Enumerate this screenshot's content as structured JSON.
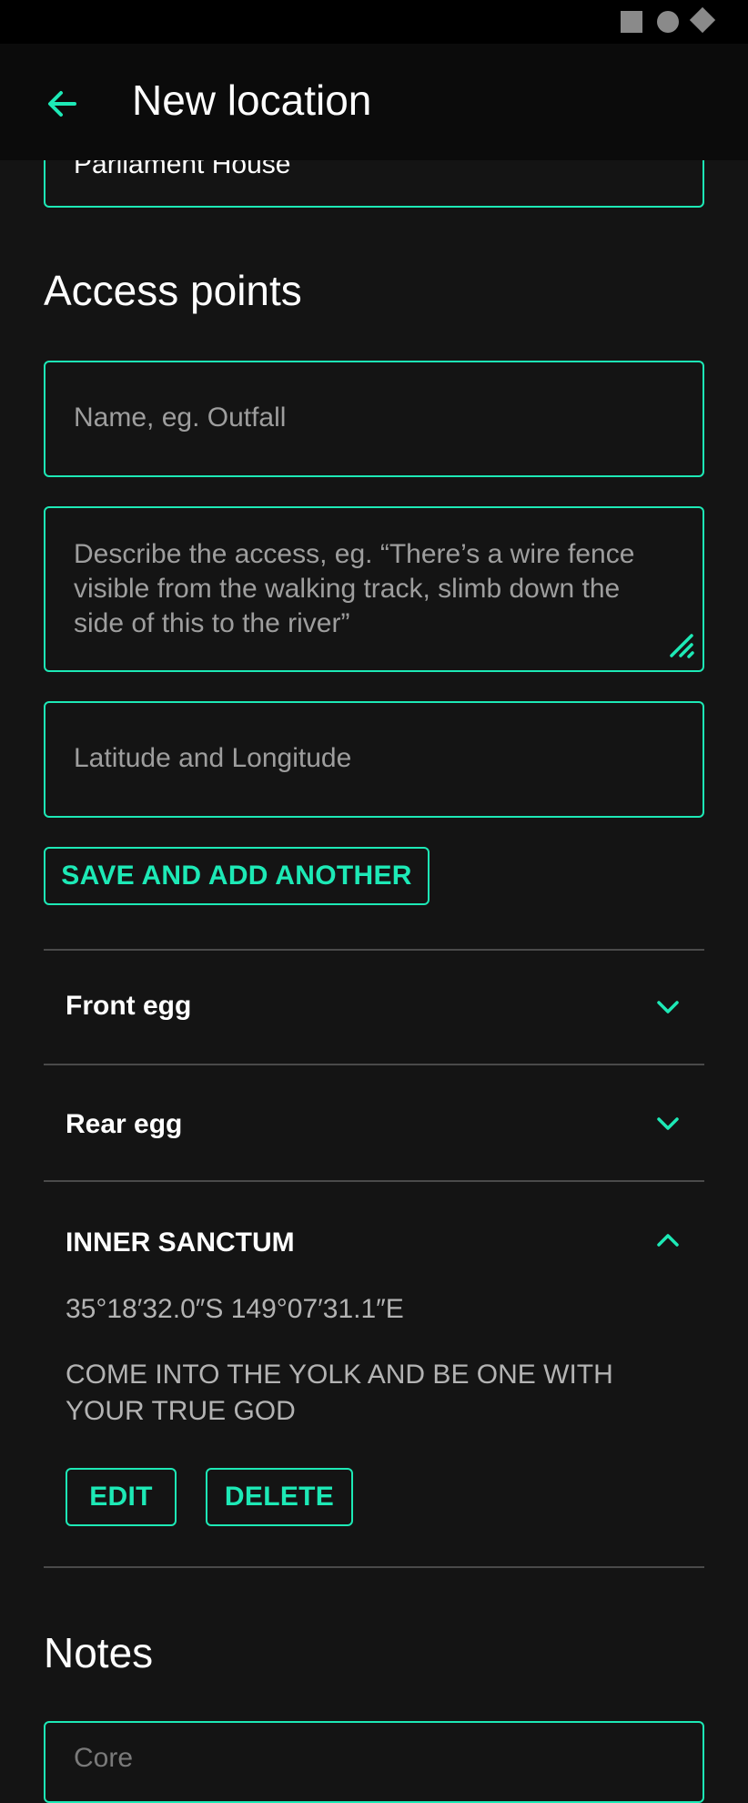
{
  "app": {
    "title": "New location"
  },
  "form": {
    "location_name_value": "Parliament House",
    "access_points_title": "Access points",
    "name_placeholder": "Name, eg. Outfall",
    "description_placeholder": "Describe the access, eg. “There’s a wire fence visible from the walking track, slimb down the side of this to the river”",
    "latlng_placeholder": "Latitude and Longitude",
    "save_add_another_label": "SAVE AND ADD ANOTHER"
  },
  "access_points": [
    {
      "name": "Front egg",
      "expanded": false
    },
    {
      "name": "Rear egg",
      "expanded": false
    },
    {
      "name": "INNER SANCTUM",
      "expanded": true,
      "coordinates": "35°18′32.0″S 149°07′31.1″E",
      "description": "COME INTO THE YOLK AND BE ONE WITH YOUR TRUE GOD",
      "edit_label": "EDIT",
      "delete_label": "DELETE"
    }
  ],
  "notes": {
    "title": "Notes",
    "placeholder": "Core"
  },
  "colors": {
    "accent": "#1de9b6",
    "background": "#141414",
    "appbar": "#0b0b0b"
  },
  "icons": {
    "back": "arrow-left-icon",
    "expand": "chevron-down-icon",
    "collapse": "chevron-up-icon",
    "resize": "resize-handle-icon"
  }
}
